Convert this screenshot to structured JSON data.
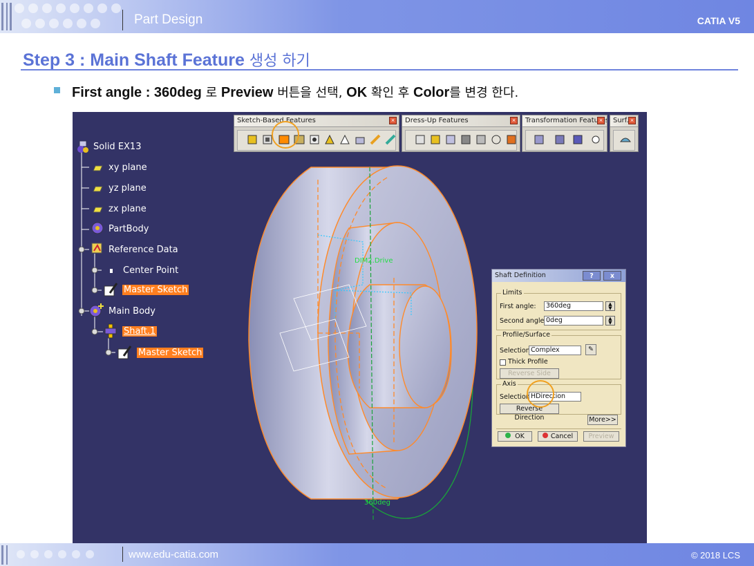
{
  "header": {
    "title": "Part Design",
    "product": "CATIA V5"
  },
  "step": {
    "en": "Step 3 : Main Shaft Feature",
    "kr": "생성 하기"
  },
  "instruction": {
    "p1": "First angle : 360deg",
    "k1": " 로 ",
    "p2": "Preview",
    "k2": " 버튼을 선택, ",
    "p3": "OK",
    "k3": " 확인 후 ",
    "p4": "Color",
    "k4": "를 변경 한다."
  },
  "tree": {
    "root": "Solid EX13",
    "xy": "xy plane",
    "yz": "yz plane",
    "zx": "zx plane",
    "partbody": "PartBody",
    "refdata": "Reference Data",
    "center": "Center Point",
    "master1": "Master Sketch",
    "mainbody": "Main Body",
    "shaft": "Shaft.1",
    "master2": "Master Sketch"
  },
  "toolbars": {
    "sketch": "Sketch-Based Features",
    "dress": "Dress-Up Features",
    "transform": "Transformation Features",
    "surf": "Surf..."
  },
  "viewport": {
    "dim_label": "DIM2.Drive",
    "angle_label": "360deg"
  },
  "dialog": {
    "title": "Shaft Definition",
    "help": "?",
    "close": "x",
    "limits": "Limits",
    "first_angle_label": "First angle:",
    "first_angle": "360deg",
    "second_angle_label": "Second angle:",
    "second_angle": "0deg",
    "profile": "Profile/Surface",
    "selection_label": "Selection:",
    "profile_sel": "Complex",
    "thick": "Thick Profile",
    "reverse_side": "Reverse Side",
    "axis": "Axis",
    "axis_sel_label": "Selection:",
    "axis_sel": "HDirection",
    "reverse_dir": "Reverse Direction",
    "more": "More>>",
    "ok": "OK",
    "cancel": "Cancel",
    "preview": "Preview"
  },
  "footer": {
    "url": "www.edu-catia.com",
    "copyright": "© 2018 LCS"
  },
  "colors": {
    "accent": "#5b73d6",
    "highlight": "#ff7f1f",
    "viewport_bg": "#333366",
    "dialog_bg": "#f0e6c2"
  }
}
